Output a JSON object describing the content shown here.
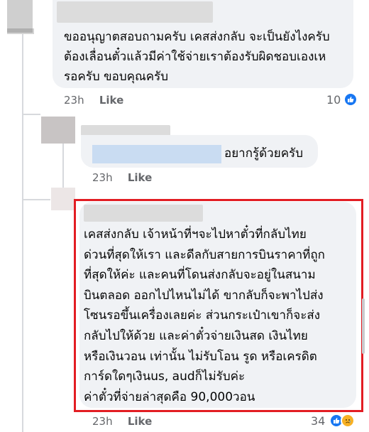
{
  "comment1": {
    "text": "ขออนุญาตสอบถามครับ เคสส่งกลับ จะเป็นยังไงครับ\nต้องเลื่อนตั๋วแล้วมีค่าใช้จ่ายเราต้องรับผิดชอบเองเห\nรอครับ ขอบคุณครับ",
    "time": "23h",
    "like_label": "Like",
    "reaction_count": "10"
  },
  "reply1": {
    "text": "อยากรู้ด้วยครับ",
    "time": "23h",
    "like_label": "Like"
  },
  "reply2": {
    "text": "เคสส่งกลับ เจ้าหน้าที่ฯจะไปหาตั๋วที่กลับไทย\nด่วนที่สุดให้เรา และดีลกับสายการบินราคาที่ถูก\nที่สุดให้ค่ะ และคนที่โดนส่งกลับจะอยู่ในสนาม\nบินตลอด ออกไปไหนไม่ได้ ขากลับก็จะพาไปส่ง\nโซนรอขึ้นเครื่องเลยค่ะ ส่วนกระเป๋าเขาก็จะส่ง\nกลับไปให้ด้วย และค่าตั๋วจ่ายเงินสด เงินไทย\nหรือเงินวอน เท่านั้น ไม่รับโอน รูด หรือเครดิต\nการ์ดใดๆเงินus, audก็ไม่รับค่ะ\nค่าตั๋วที่จ่ายล่าสุดคือ 90,000วอน",
    "time": "23h",
    "like_label": "Like",
    "reaction_count": "34"
  },
  "colors": {
    "like_blue": "#1877f2",
    "highlight_red": "#e21d23",
    "sad_yellow": "#f7b125"
  },
  "icons": [
    "like-reaction-icon",
    "sad-reaction-icon"
  ]
}
